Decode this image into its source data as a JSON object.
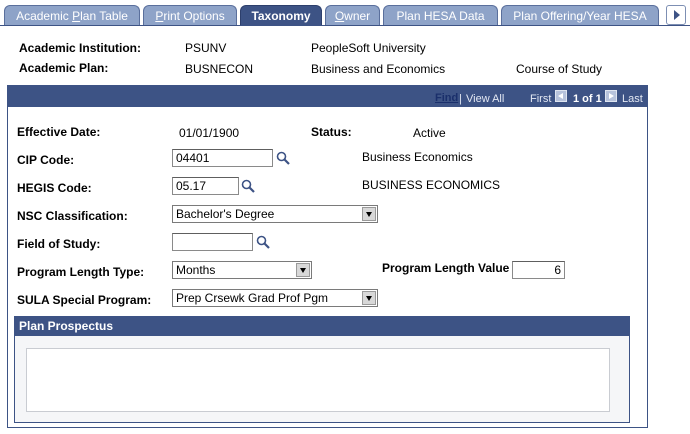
{
  "tabs": [
    {
      "label": "Academic Plan Table",
      "underline": "P",
      "pre": "Academic ",
      "post": "lan Table",
      "active": false
    },
    {
      "label": "Print Options",
      "underline": "P",
      "pre": "",
      "post": "rint Options",
      "active": false
    },
    {
      "label": "Taxonomy",
      "active": true
    },
    {
      "label": "Owner",
      "underline": "O",
      "pre": "",
      "post": "wner",
      "active": false
    },
    {
      "label": "Plan HESA Data",
      "active": false
    },
    {
      "label": "Plan Offering/Year HESA",
      "active": false
    }
  ],
  "header": {
    "institution_label": "Academic Institution:",
    "institution_code": "PSUNV",
    "institution_name": "PeopleSoft University",
    "plan_label": "Academic Plan:",
    "plan_code": "BUSNECON",
    "plan_name": "Business and Economics",
    "plan_type": "Course of Study"
  },
  "nav": {
    "find": "Find",
    "view_all": "View All",
    "first": "First",
    "count": "1 of 1",
    "last": "Last"
  },
  "form": {
    "effective_date_label": "Effective Date:",
    "effective_date": "01/01/1900",
    "status_label": "Status:",
    "status": "Active",
    "cip_label": "CIP Code:",
    "cip_value": "04401",
    "cip_desc": "Business Economics",
    "hegis_label": "HEGIS Code:",
    "hegis_value": "05.17",
    "hegis_desc": "BUSINESS ECONOMICS",
    "nsc_label": "NSC Classification:",
    "nsc_value": "Bachelor's Degree",
    "field_label": "Field of Study:",
    "field_value": "",
    "length_type_label": "Program Length Type:",
    "length_type_value": "Months",
    "length_value_label": "Program Length Value",
    "length_value": "6",
    "sula_label": "SULA Special Program:",
    "sula_value": "Prep Crsewk Grad Prof Pgm"
  },
  "prospectus": {
    "title": "Plan Prospectus",
    "text": ""
  },
  "colors": {
    "tab_bg": "#8ea3c8",
    "tab_active": "#3d5385",
    "header_bar": "#3d5385"
  }
}
